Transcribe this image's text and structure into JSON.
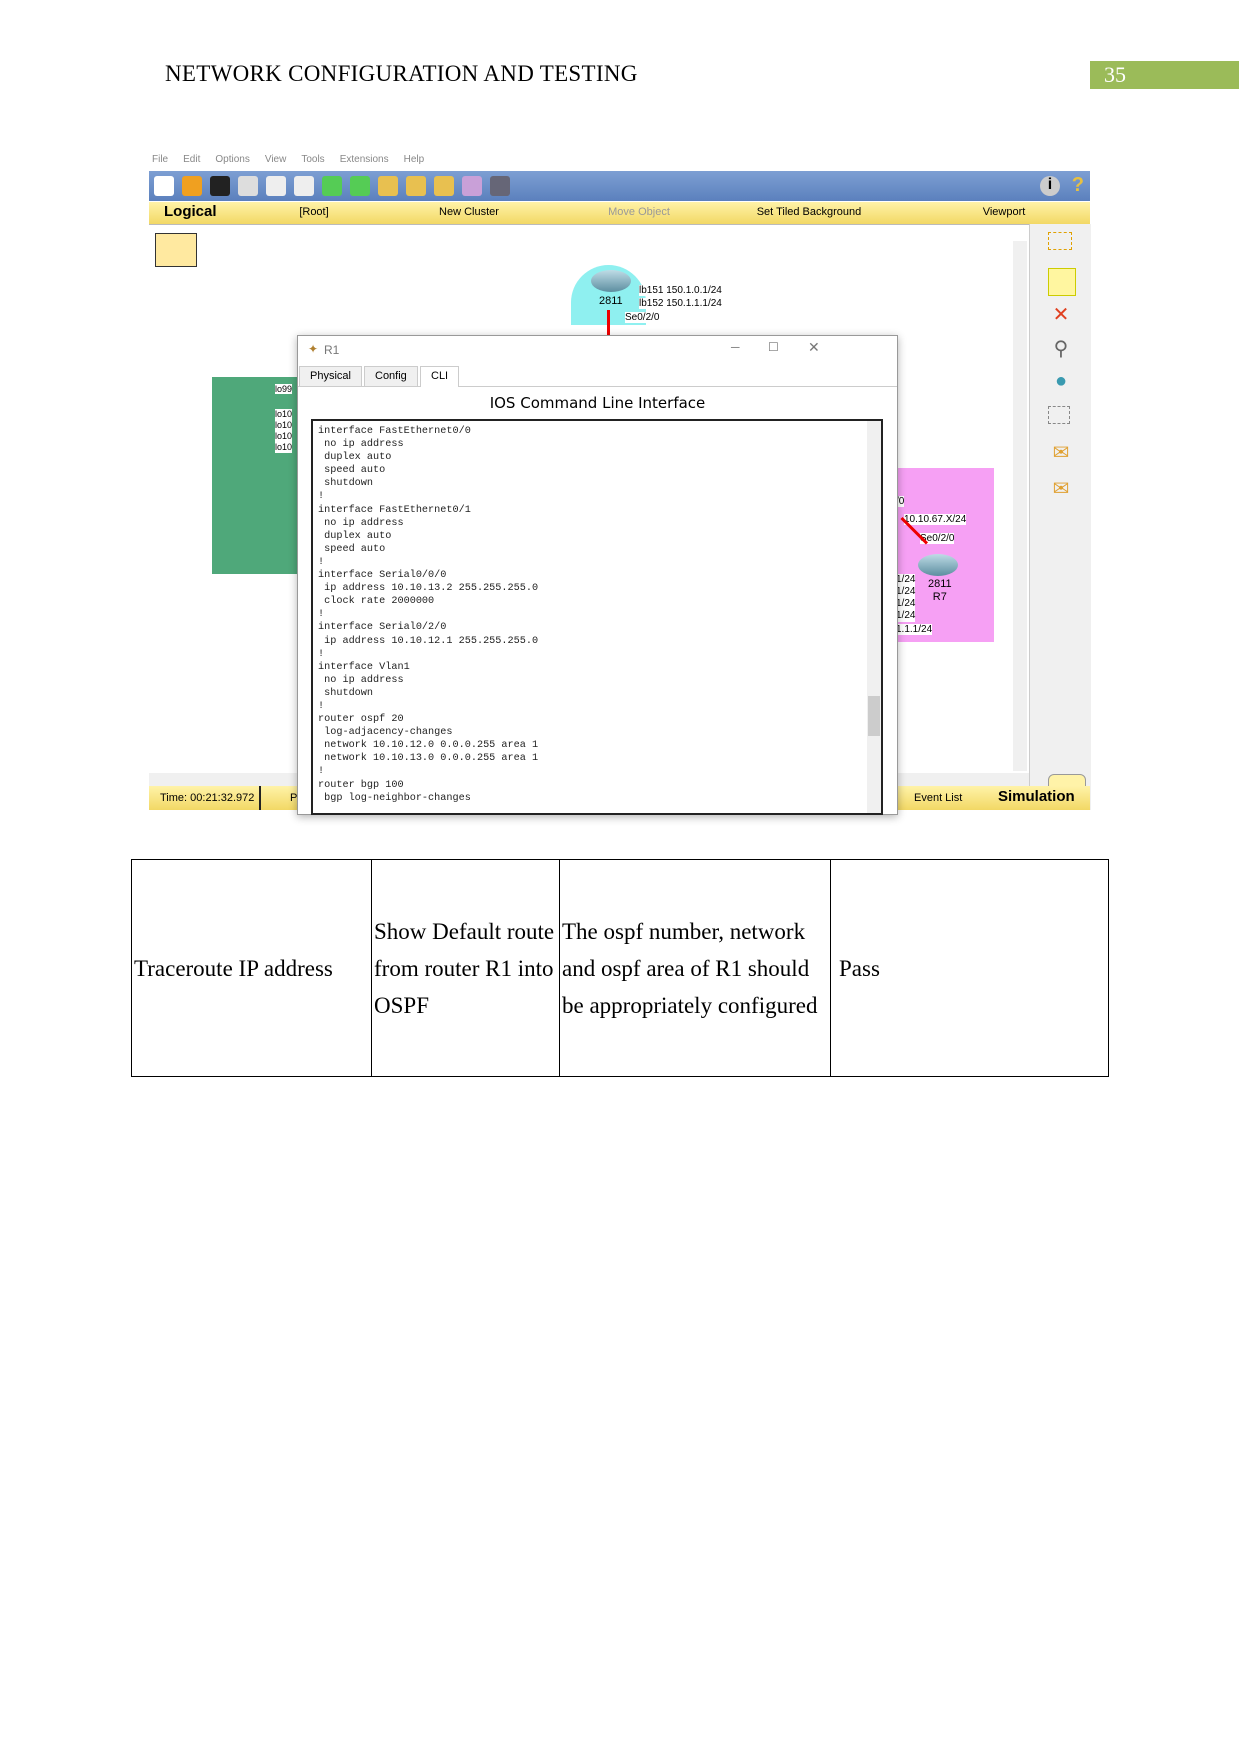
{
  "header": {
    "title": "NETWORK CONFIGURATION AND TESTING",
    "page_number": "35"
  },
  "pt": {
    "menu": [
      "File",
      "Edit",
      "Options",
      "View",
      "Tools",
      "Extensions",
      "Help"
    ],
    "bar": {
      "logical": "Logical",
      "root": "[Root]",
      "new_cluster": "New Cluster",
      "move_object": "Move Object",
      "set_tiled": "Set Tiled Background",
      "viewport": "Viewport"
    },
    "router_top": {
      "model": "2811",
      "lb151": "lb151 150.1.0.1/24",
      "lb152": "lb152 150.1.1.1/24",
      "port": "Se0/2/0"
    },
    "green_labels": [
      "lo99",
      "lo10",
      "lo10",
      "lo10",
      "lo10"
    ],
    "r7": {
      "model": "2811",
      "name": "R7",
      "net": "10.10.67.X/24",
      "port": "Se0/2/0",
      "left_frag": "/0",
      "frags": [
        "1/24",
        "1/24",
        "1/24",
        "1/24"
      ],
      "last": "1.1.1/24"
    },
    "status": {
      "time": "Time: 00:21:32.972",
      "frag": "P",
      "event_list": "Event List",
      "simulation": "Simulation"
    }
  },
  "dialog": {
    "title": "R1",
    "tabs": [
      "Physical",
      "Config",
      "CLI"
    ],
    "active_tab": "CLI",
    "heading": "IOS Command Line Interface",
    "cli": "interface FastEthernet0/0\n no ip address\n duplex auto\n speed auto\n shutdown\n!\ninterface FastEthernet0/1\n no ip address\n duplex auto\n speed auto\n!\ninterface Serial0/0/0\n ip address 10.10.13.2 255.255.255.0\n clock rate 2000000\n!\ninterface Serial0/2/0\n ip address 10.10.12.1 255.255.255.0\n!\ninterface Vlan1\n no ip address\n shutdown\n!\nrouter ospf 20\n log-adjacency-changes\n network 10.10.12.0 0.0.0.255 area 1\n network 10.10.13.0 0.0.0.255 area 1\n!\nrouter bgp 100\n bgp log-neighbor-changes"
  },
  "table": {
    "rows": [
      [
        "Traceroute IP address",
        "Show Default route from router R1 into OSPF",
        "The ospf number, network and ospf area of R1 should be appropriately configured",
        "Pass"
      ]
    ]
  }
}
